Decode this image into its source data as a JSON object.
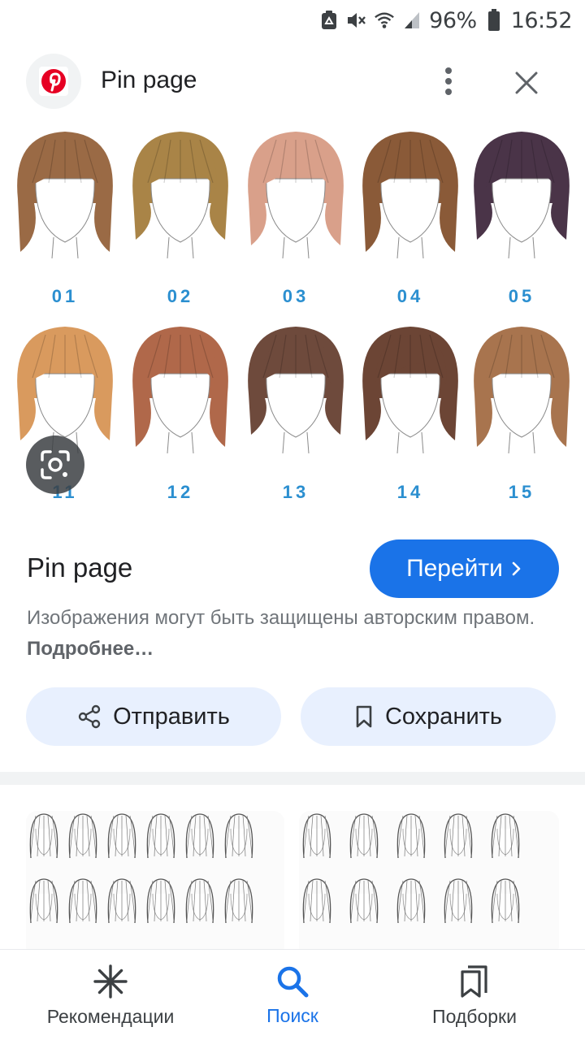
{
  "status_bar": {
    "battery": "96%",
    "time": "16:52",
    "icons": [
      "recycle-icon",
      "mute-icon",
      "wifi-icon",
      "signal-icon",
      "battery-icon"
    ]
  },
  "header": {
    "title": "Pin page",
    "logo": "pinterest-logo",
    "more_icon": "more-vert-icon",
    "close_icon": "close-icon"
  },
  "hero": {
    "labels": [
      "01",
      "02",
      "03",
      "04",
      "05",
      "11",
      "12",
      "13",
      "14",
      "15"
    ],
    "hair_colors": [
      "#9a6a45",
      "#a98447",
      "#d9a08a",
      "#8a5a38",
      "#4a3448",
      "#d99a5e",
      "#b0684a",
      "#6e4a3c",
      "#6c4535",
      "#a8744e"
    ],
    "label_color": "#2b8fd0",
    "lens_icon": "google-lens-icon"
  },
  "info": {
    "source_title": "Pin page",
    "visit_label": "Перейти",
    "copyright_text": "Изображения могут быть защищены авторским правом.",
    "more_link": "Подробнее…",
    "share_label": "Отправить",
    "save_label": "Сохранить"
  },
  "bottom_nav": {
    "items": [
      {
        "label": "Рекомендации",
        "icon": "discover-asterisk-icon"
      },
      {
        "label": "Поиск",
        "icon": "search-icon"
      },
      {
        "label": "Подборки",
        "icon": "collections-icon"
      }
    ],
    "active_index": 1
  },
  "colors": {
    "accent": "#1a73e8",
    "chip_bg": "#e8f0fe",
    "pinterest_red": "#e60023"
  }
}
